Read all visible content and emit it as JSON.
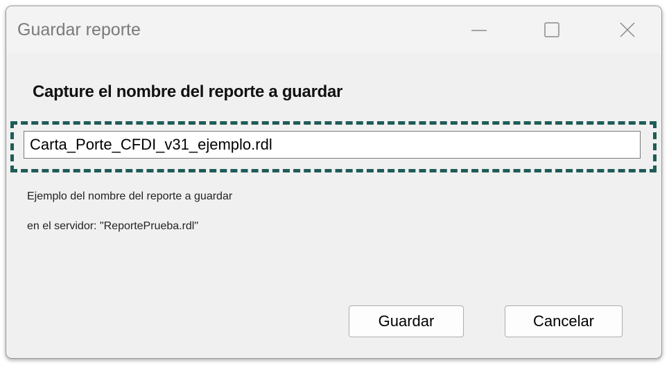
{
  "window": {
    "title": "Guardar reporte"
  },
  "dialog": {
    "heading": "Capture el nombre del reporte a guardar",
    "filename_value": "Carta_Porte_CFDI_v31_ejemplo.rdl",
    "hint_line1": "Ejemplo del nombre del reporte a guardar",
    "hint_line2": "en el servidor: \"ReportePrueba.rdl\""
  },
  "buttons": {
    "save_label": "Guardar",
    "cancel_label": "Cancelar"
  },
  "colors": {
    "highlight_border": "#1f5c58",
    "window_background": "#f0f0f0"
  },
  "icons": {
    "minimize": "minimize-icon",
    "maximize": "maximize-icon",
    "close": "close-icon"
  }
}
